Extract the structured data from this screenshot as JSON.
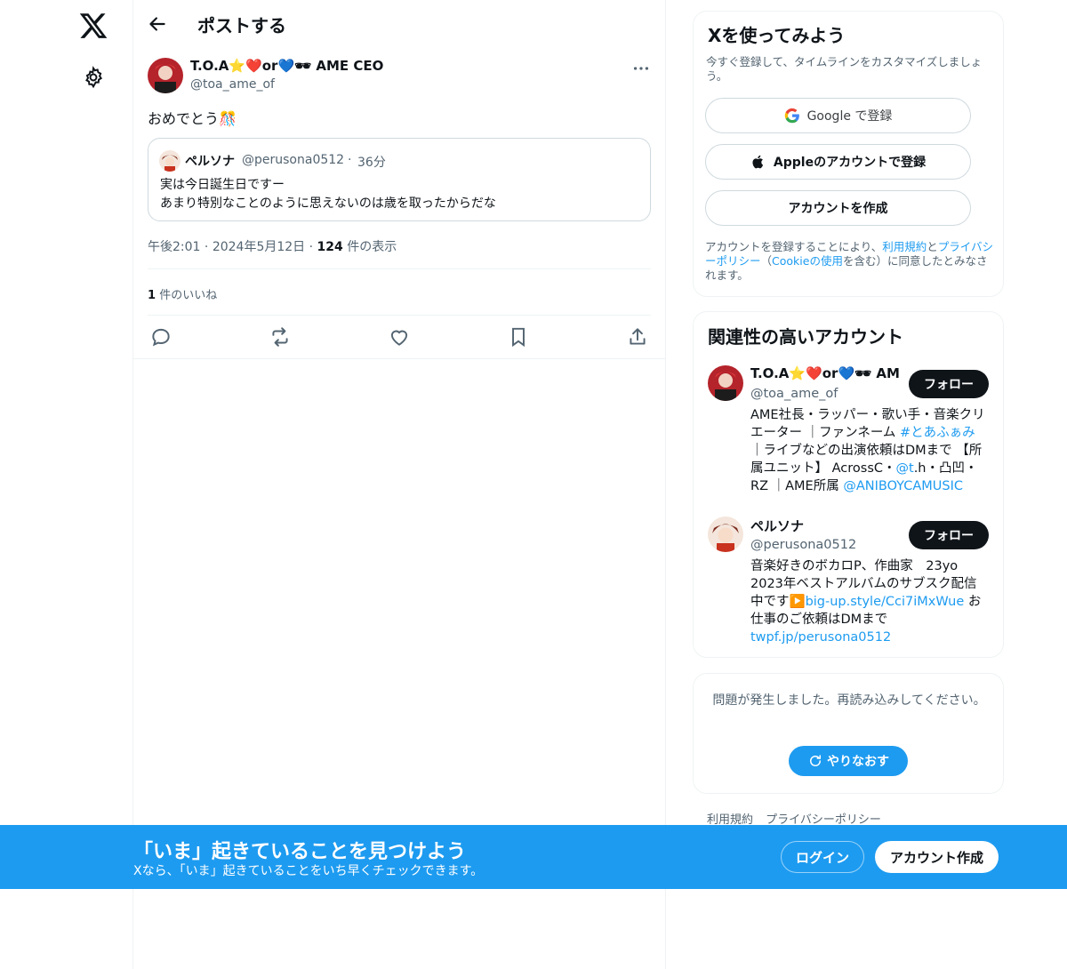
{
  "header": {
    "title": "ポストする"
  },
  "post": {
    "author_name": "T.O.A⭐❤️or💙🕶 AME CEO",
    "author_handle": "@toa_ame_of",
    "text": "おめでとう🎊",
    "quote": {
      "name": "ペルソナ",
      "handle": "@perusona0512",
      "separator": "·",
      "time": "36分",
      "line1": "実は今日誕生日ですー",
      "line2": "あまり特別なことのように思えないのは歳を取ったからだな"
    },
    "meta": {
      "time": "午後2:01",
      "date": "2024年5月12日",
      "views_count": "124",
      "views_label": "件の表示",
      "separator": "·"
    },
    "likes_count": "1",
    "likes_label": "件のいいね"
  },
  "signup_card": {
    "title": "Xを使ってみよう",
    "subtitle": "今すぐ登録して、タイムラインをカスタマイズしましょう。",
    "google_label": "Google で登録",
    "apple_label": "Appleのアカウントで登録",
    "create_label": "アカウントを作成",
    "terms": {
      "prefix": "アカウントを登録することにより、",
      "tos": "利用規約",
      "and": "と",
      "privacy": "プライバシーポリシー",
      "paren_open": "（",
      "cookie": "Cookieの使用",
      "suffix": "を含む）に同意したとみなされます。"
    }
  },
  "related": {
    "title": "関連性の高いアカウント",
    "accounts": [
      {
        "name": "T.O.A⭐❤️or💙🕶 AME CEO",
        "handle": "@toa_ame_of",
        "follow_label": "フォロー",
        "bio_1": "AME社長・ラッパー・歌い手・音楽クリエーター ｜ファンネーム ",
        "bio_link_1": "#とあふぁみ",
        "bio_2": "｜ライブなどの出演依頼はDMまで 【所属ユニット】 AcrossC・",
        "bio_link_2": "@t",
        "bio_3": ".h・凸凹・RZ ｜AME所属 ",
        "bio_link_3": "@ANIBOYCAMUSIC"
      },
      {
        "name": "ペルソナ",
        "handle": "@perusona0512",
        "follow_label": "フォロー",
        "bio_1": "音楽好きのボカロP、作曲家　23yo 2023年ベストアルバムのサブスク配信中です▶️",
        "bio_link_1": "big-up.style/Cci7iMxWue",
        "bio_2": " お仕事のご依頼はDMまで ",
        "bio_link_2": "twpf.jp/perusona0512"
      }
    ]
  },
  "error_card": {
    "message": "問題が発生しました。再読み込みしてください。",
    "retry_label": "やりなおす"
  },
  "footer": {
    "tos": "利用規約",
    "privacy": "プライバシーポリシー"
  },
  "banner": {
    "title": "「いま」起きていることを見つけよう",
    "subtitle": "Xなら、「いま」起きていることをいち早くチェックできます。",
    "login_label": "ログイン",
    "signup_label": "アカウント作成"
  },
  "colors": {
    "accent": "#1d9bf0",
    "text": "#0f1419",
    "muted": "#536471",
    "border": "#eff3f4"
  },
  "icons": [
    "x-logo-icon",
    "gear-icon",
    "back-arrow-icon",
    "more-icon",
    "reply-icon",
    "repost-icon",
    "like-icon",
    "bookmark-icon",
    "share-icon",
    "google-icon",
    "apple-icon",
    "refresh-icon"
  ]
}
